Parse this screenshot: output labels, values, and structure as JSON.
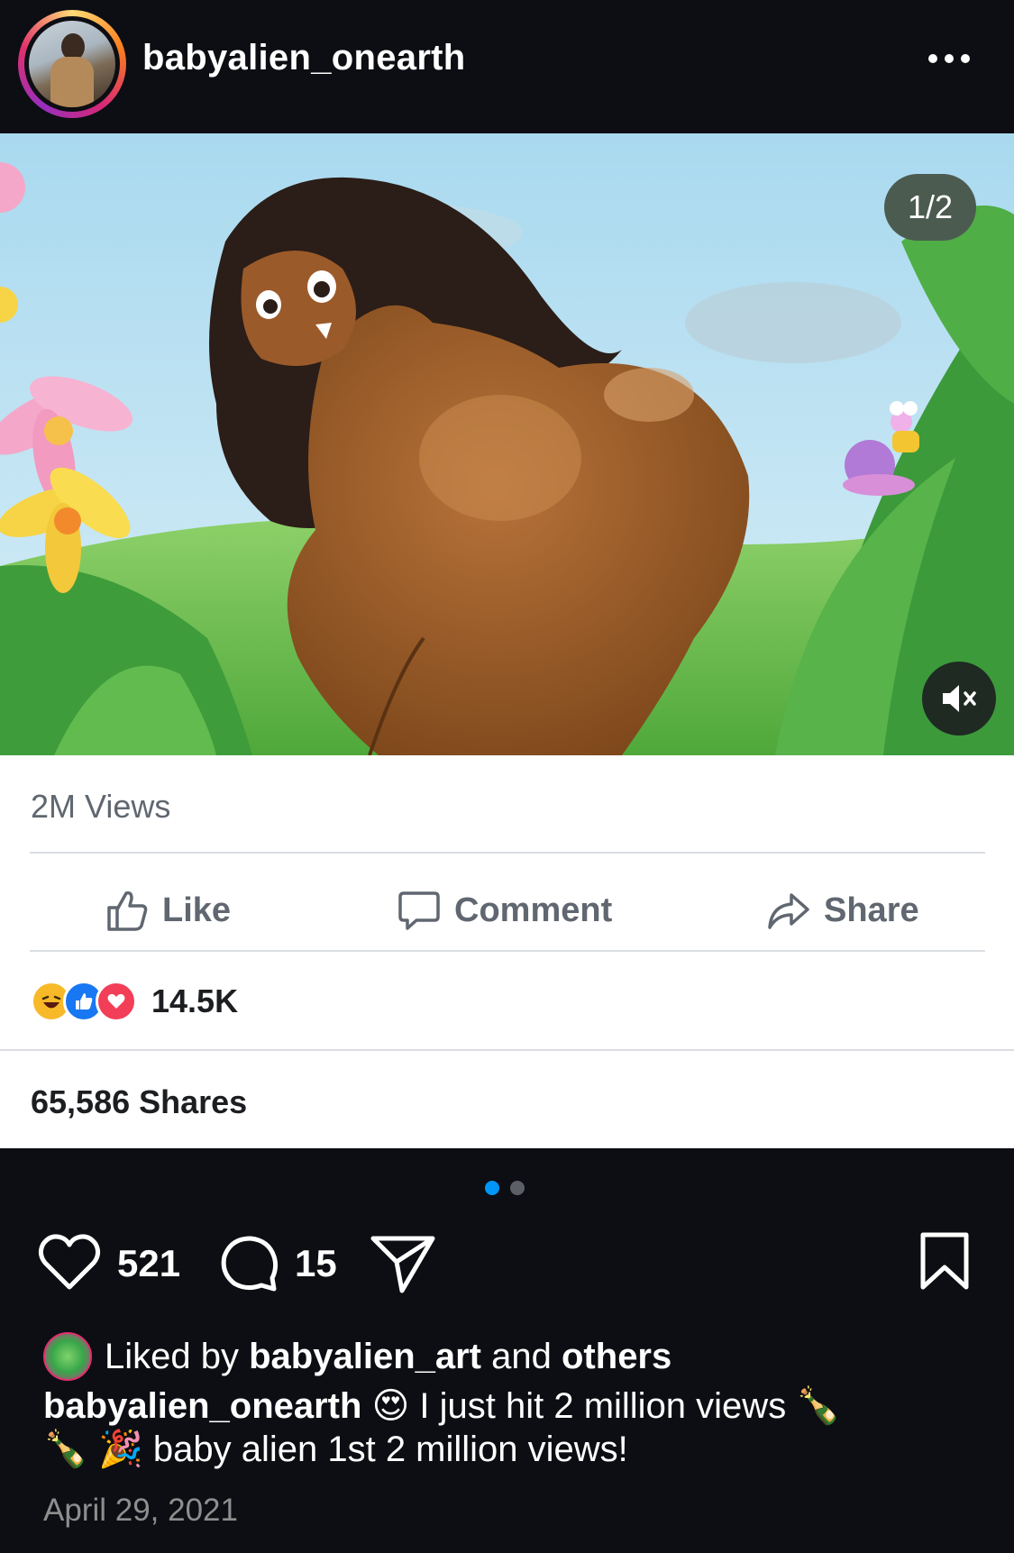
{
  "header": {
    "username": "babyalien_onearth",
    "more_icon": "more-horizontal-icon"
  },
  "media": {
    "counter": "1/2",
    "mute_icon": "volume-muted-icon"
  },
  "embedded_post": {
    "views": "2M Views",
    "actions": {
      "like": "Like",
      "comment": "Comment",
      "share": "Share"
    },
    "reactions": [
      "haha",
      "like",
      "love"
    ],
    "reaction_count": "14.5K",
    "shares": "65,586 Shares",
    "colors": {
      "like_blue": "#1877f2",
      "love_red": "#f33e58",
      "haha_yellow": "#f7b928"
    }
  },
  "carousel": {
    "total": 2,
    "active_index": 0
  },
  "actions": {
    "likes_count": "521",
    "comments_count": "15"
  },
  "caption": {
    "liked_by_prefix": "Liked by",
    "liked_by_user": "babyalien_art",
    "liked_by_and": "and",
    "liked_by_others": "others",
    "author": "babyalien_onearth",
    "text_line1": "I just hit 2 million views",
    "text_line2": "baby alien 1st 2 million views!",
    "emojis": [
      "😍",
      "🍾",
      "🍾",
      "🎉"
    ],
    "date": "April 29, 2021"
  },
  "colors": {
    "background": "#0c0e13",
    "accent_blue": "#0095f6",
    "muted_gray": "#8e8e8e"
  }
}
